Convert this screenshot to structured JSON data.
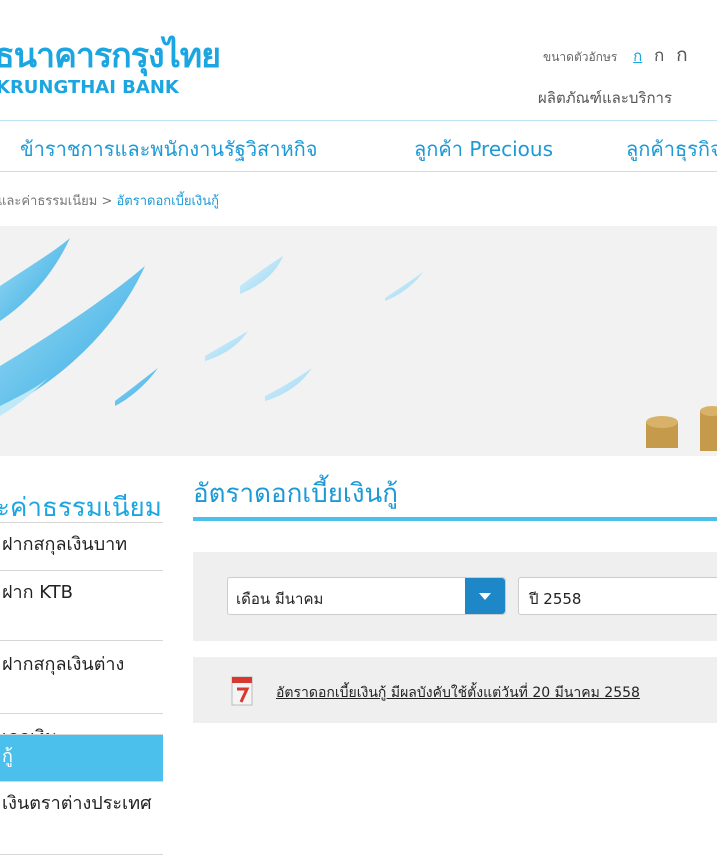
{
  "header": {
    "logo_thai": "ธนาคารกรุงไทย",
    "logo_en": "KRUNGTHAI BANK",
    "font_size_label": "ขนาดตัวอักษร",
    "font_size_options": [
      "ก",
      "ก",
      "ก"
    ],
    "products_link": "ผลิตภัณฑ์และบริการ"
  },
  "nav": {
    "items": [
      "ข้าราชการและพนักงานรัฐวิสาหกิจ",
      "ลูกค้า Precious",
      "ลูกค้าธุรกิจ"
    ]
  },
  "breadcrumb": {
    "parent": "และค่าธรรมเนียม",
    "separator": ">",
    "current": "อัตราดอกเบี้ยเงินกู้"
  },
  "sidebar": {
    "title": "ะค่าธรรมเนียม",
    "items": [
      {
        "label": "ฝากสกุลเงินบาท",
        "active": false
      },
      {
        "label": "ฝาก KTB",
        "active": false
      },
      {
        "label": "ฝากสกุลเงินต่าง",
        "active": false
      },
      {
        "label": "เลกเงิน",
        "active": false
      },
      {
        "label": "กู้",
        "active": true
      },
      {
        "label": "เงินตราต่างประเทศ",
        "active": false
      }
    ]
  },
  "main": {
    "title": "อัตราดอกเบี้ยเงินกู้",
    "month_select": "เดือน มีนาคม",
    "year_select": "ปี 2558",
    "document_link": "อัตราดอกเบี้ยเงินกู้ มีผลบังคับใช้ตั้งแต่วันที่ 20 มีนาคม 2558",
    "document_icon": "pdf-document-icon"
  },
  "colors": {
    "brand": "#1ba5e1",
    "active_item": "#4bc0ec",
    "dropdown_button": "#1d87c8"
  }
}
